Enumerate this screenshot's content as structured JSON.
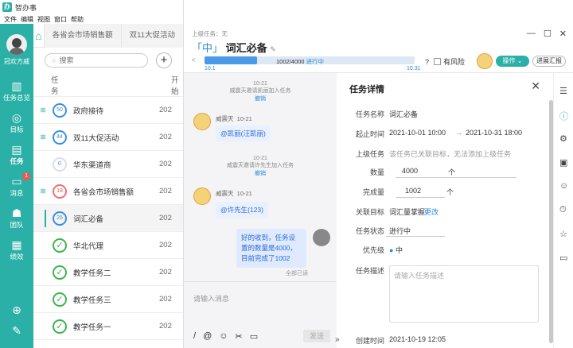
{
  "app": {
    "title": "智办事",
    "logo": "办"
  },
  "menu": [
    "文件",
    "编辑",
    "视图",
    "窗口",
    "帮助"
  ],
  "window_buttons": {
    "minimize": "—",
    "maximize": "☐",
    "close": "✕"
  },
  "sidebar": {
    "user_name": "冠欢方威",
    "items": [
      {
        "label": "任务总览",
        "icon": "▥"
      },
      {
        "label": "目标",
        "icon": "◎"
      },
      {
        "label": "任务",
        "icon": "▤"
      },
      {
        "label": "消息",
        "icon": "▭",
        "badge": "1"
      },
      {
        "label": "团队",
        "icon": "☗"
      },
      {
        "label": "绩效",
        "icon": "▦"
      }
    ],
    "bottom_icons": [
      "⊕",
      "✎"
    ]
  },
  "list": {
    "tabs": [
      "各省会市场销售额",
      "双11大促活动"
    ],
    "search_placeholder": "搜索",
    "add_label": "+",
    "col_task": "任务",
    "col_start": "开始",
    "rows": [
      {
        "kind": "ring",
        "sub": "⊞",
        "pct": "50",
        "name": "政府接待",
        "date": "202"
      },
      {
        "kind": "ring",
        "sub": "⊞",
        "pct": "44",
        "name": "双11大促活动",
        "date": "202"
      },
      {
        "kind": "ring-gray",
        "sub": "",
        "pct": "0",
        "name": "华东渠道商",
        "date": "202"
      },
      {
        "kind": "ring-red",
        "sub": "⊞",
        "pct": "18",
        "name": "各省会市场销售额",
        "date": "202"
      },
      {
        "kind": "ring",
        "sub": "",
        "pct": "25",
        "name": "词汇必备",
        "date": "202",
        "active": true
      },
      {
        "kind": "check",
        "sub": "",
        "pct": "✓",
        "name": "华北代理",
        "date": "202"
      },
      {
        "kind": "check",
        "sub": "",
        "pct": "✓",
        "name": "教学任务二",
        "date": "202"
      },
      {
        "kind": "check",
        "sub": "",
        "pct": "✓",
        "name": "教学任务三",
        "date": "202"
      },
      {
        "kind": "check",
        "sub": "",
        "pct": "✓",
        "name": "教学任务一",
        "date": "202"
      }
    ]
  },
  "detail": {
    "parent_label": "上级任务：无",
    "bracket": "「中」",
    "title": "词汇必备",
    "edit_icon": "✎",
    "back_icon": "<",
    "progress": {
      "fraction": 0.25,
      "text": "1002/4000",
      "status": "进行中",
      "start": "10.1",
      "end": "10.31"
    },
    "risk_label": "有风险",
    "help_icon": "?",
    "op_button": "操作 ⌄",
    "report_button": "进展汇报",
    "top_icons": [
      "—",
      "☐",
      "✕"
    ],
    "chat": {
      "sys1_time": "10-21",
      "sys1_text": "威震天邀请凯丽加入任务",
      "sys1_undo": "撤销",
      "msg1_name": "威震天",
      "msg1_time": "10-21",
      "msg1_text": "@凯丽(汪凯丽)",
      "sys2_time": "10-21",
      "sys2_text": "威震天邀请许先生加入任务",
      "sys2_undo": "撤销",
      "msg2_name": "威震天",
      "msg2_time": "10-21",
      "msg2_text": "@许先生(123)",
      "my_text": "好的收到，任务设置的数量是4000，目前完成了1002",
      "read_all": "全部已读",
      "input_placeholder": "请输入消息",
      "tools": [
        "/",
        "@",
        "☺",
        "✂",
        "▭"
      ],
      "send": "发送",
      "collapse": "»"
    },
    "form": {
      "title": "任务详情",
      "close": "✕",
      "name_label": "任务名称",
      "name_value": "词汇必备",
      "time_label": "起止时间",
      "time_start": "2021-10-01 10:00",
      "time_arrow": "→",
      "time_end": "2021-10-31 18:00",
      "parent_label": "上级任务",
      "parent_hint": "该任务已关联目标，无法添加上级任务",
      "qty_label": "数量",
      "qty_value": "4000",
      "qty_unit": "个",
      "done_label": "完成量",
      "done_value": "1002",
      "done_unit": "个",
      "goal_label": "关联目标",
      "goal_value": "词汇量掌握",
      "goal_link": "更改",
      "status_label": "任务状态",
      "status_value": "进行中",
      "priority_label": "优先级",
      "priority_value": "中",
      "desc_label": "任务描述",
      "desc_placeholder": "请输入任务描述",
      "created_label": "创建时间",
      "created_value": "2021-10-19 12:05"
    },
    "right_icons": [
      "☰",
      "ⓘ",
      "⚙",
      "▣",
      "☺",
      "⏱",
      "☆",
      "▭"
    ]
  }
}
